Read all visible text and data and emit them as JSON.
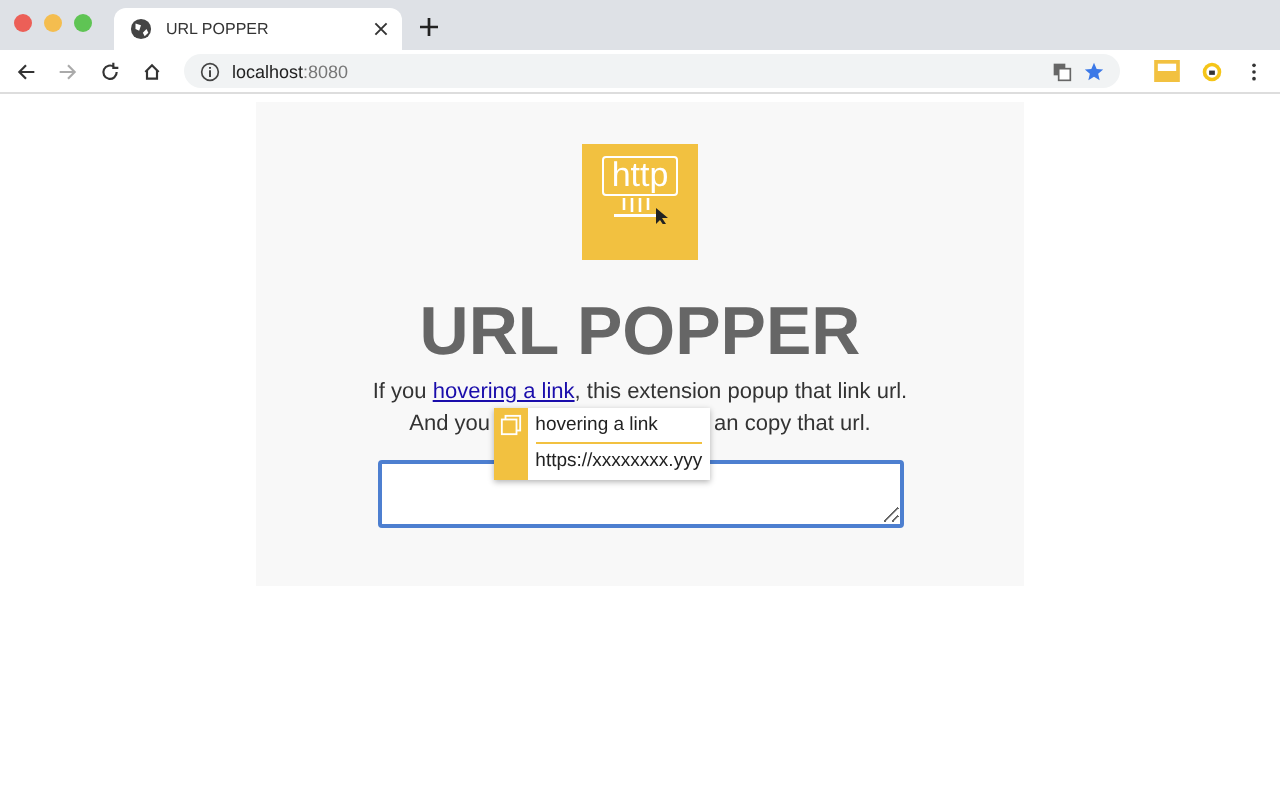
{
  "browser": {
    "tab": {
      "title": "URL POPPER",
      "selected": true
    },
    "address": {
      "host": "localhost",
      "port": ":8080"
    }
  },
  "page": {
    "logo": {
      "text": "http"
    },
    "title": "URL POPPER",
    "line_1": {
      "before": "If you ",
      "link": "hovering a link",
      "after": ", this extension popup that link url."
    },
    "line_2": {
      "start": "And you",
      "end": "an copy that url."
    },
    "popup": {
      "rows": [
        "hovering a link",
        "https://xxxxxxxx.yyy"
      ]
    }
  }
}
